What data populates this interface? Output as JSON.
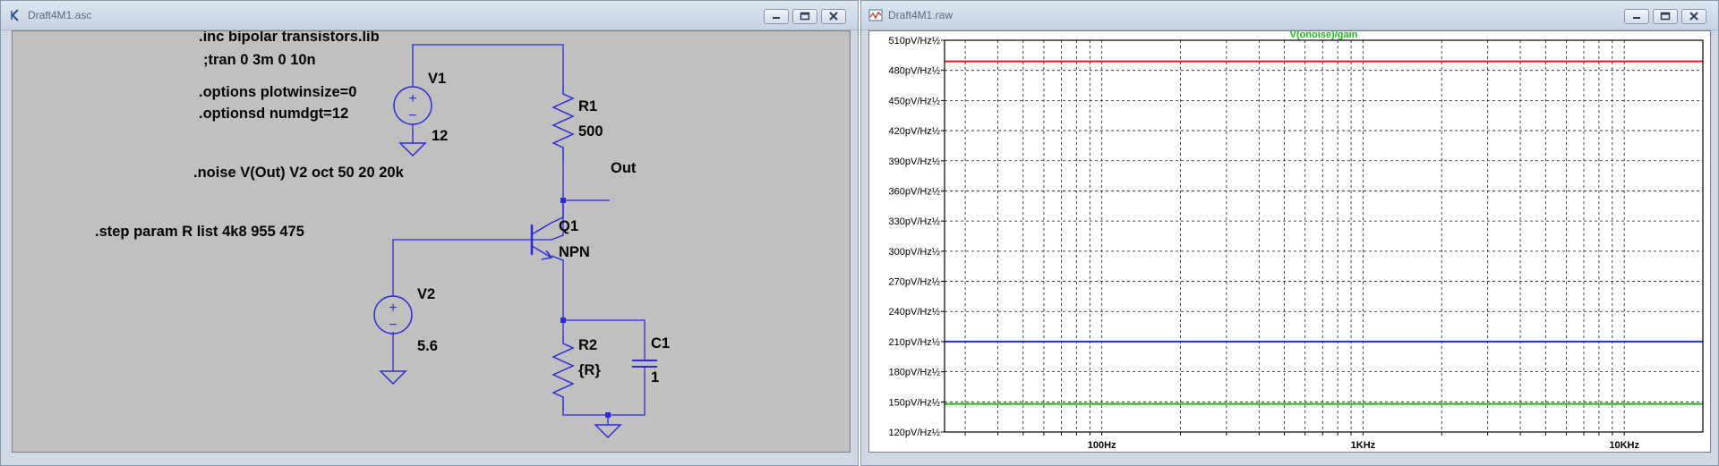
{
  "schematic_window": {
    "title": "Draft4M1.asc",
    "directives": {
      "inc": ".inc bipolar transistors.lib",
      "tran": ";tran 0 3m 0 10n",
      "options1": ".options plotwinsize=0",
      "options2": ".optionsd numdgt=12",
      "noise": ".noise V(Out) V2 oct 50 20 20k",
      "step": ".step param R list 4k8 955 475"
    },
    "components": {
      "v1": {
        "name": "V1",
        "value": "12"
      },
      "r1": {
        "name": "R1",
        "value": "500"
      },
      "net_out": "Out",
      "q1": {
        "name": "Q1",
        "value": "NPN"
      },
      "v2": {
        "name": "V2",
        "value": "5.6"
      },
      "r2": {
        "name": "R2",
        "value": "{R}"
      },
      "c1": {
        "name": "C1",
        "value": "1"
      }
    },
    "wire_color": "#2b2bd9"
  },
  "plot_window": {
    "title": "Draft4M1.raw",
    "chart_data": {
      "type": "line",
      "title": "V(onoise)/gain",
      "xscale": "log",
      "xlim": [
        25,
        20000
      ],
      "ylim": [
        120,
        510
      ],
      "y_unit": "pV/Hz½",
      "yticks": [
        {
          "value": 510,
          "label": "510pV/Hz½"
        },
        {
          "value": 480,
          "label": "480pV/Hz½"
        },
        {
          "value": 450,
          "label": "450pV/Hz½"
        },
        {
          "value": 420,
          "label": "420pV/Hz½"
        },
        {
          "value": 390,
          "label": "390pV/Hz½"
        },
        {
          "value": 360,
          "label": "360pV/Hz½"
        },
        {
          "value": 330,
          "label": "330pV/Hz½"
        },
        {
          "value": 300,
          "label": "300pV/Hz½"
        },
        {
          "value": 270,
          "label": "270pV/Hz½"
        },
        {
          "value": 240,
          "label": "240pV/Hz½"
        },
        {
          "value": 210,
          "label": "210pV/Hz½"
        },
        {
          "value": 180,
          "label": "180pV/Hz½"
        },
        {
          "value": 150,
          "label": "150pV/Hz½"
        },
        {
          "value": 120,
          "label": "120pV/Hz½"
        }
      ],
      "xticks": [
        {
          "value": 100,
          "label": "100Hz"
        },
        {
          "value": 1000,
          "label": "1KHz"
        },
        {
          "value": 10000,
          "label": "10KHz"
        }
      ],
      "grid": true,
      "series": [
        {
          "color": "#d41e1e",
          "x": [
            25,
            20000
          ],
          "y": [
            489,
            489
          ]
        },
        {
          "color": "#1f2fd6",
          "x": [
            25,
            20000
          ],
          "y": [
            210,
            210
          ]
        },
        {
          "color": "#1fae1f",
          "x": [
            25,
            20000
          ],
          "y": [
            148,
            148
          ]
        }
      ],
      "title_color": "#22b922"
    }
  }
}
